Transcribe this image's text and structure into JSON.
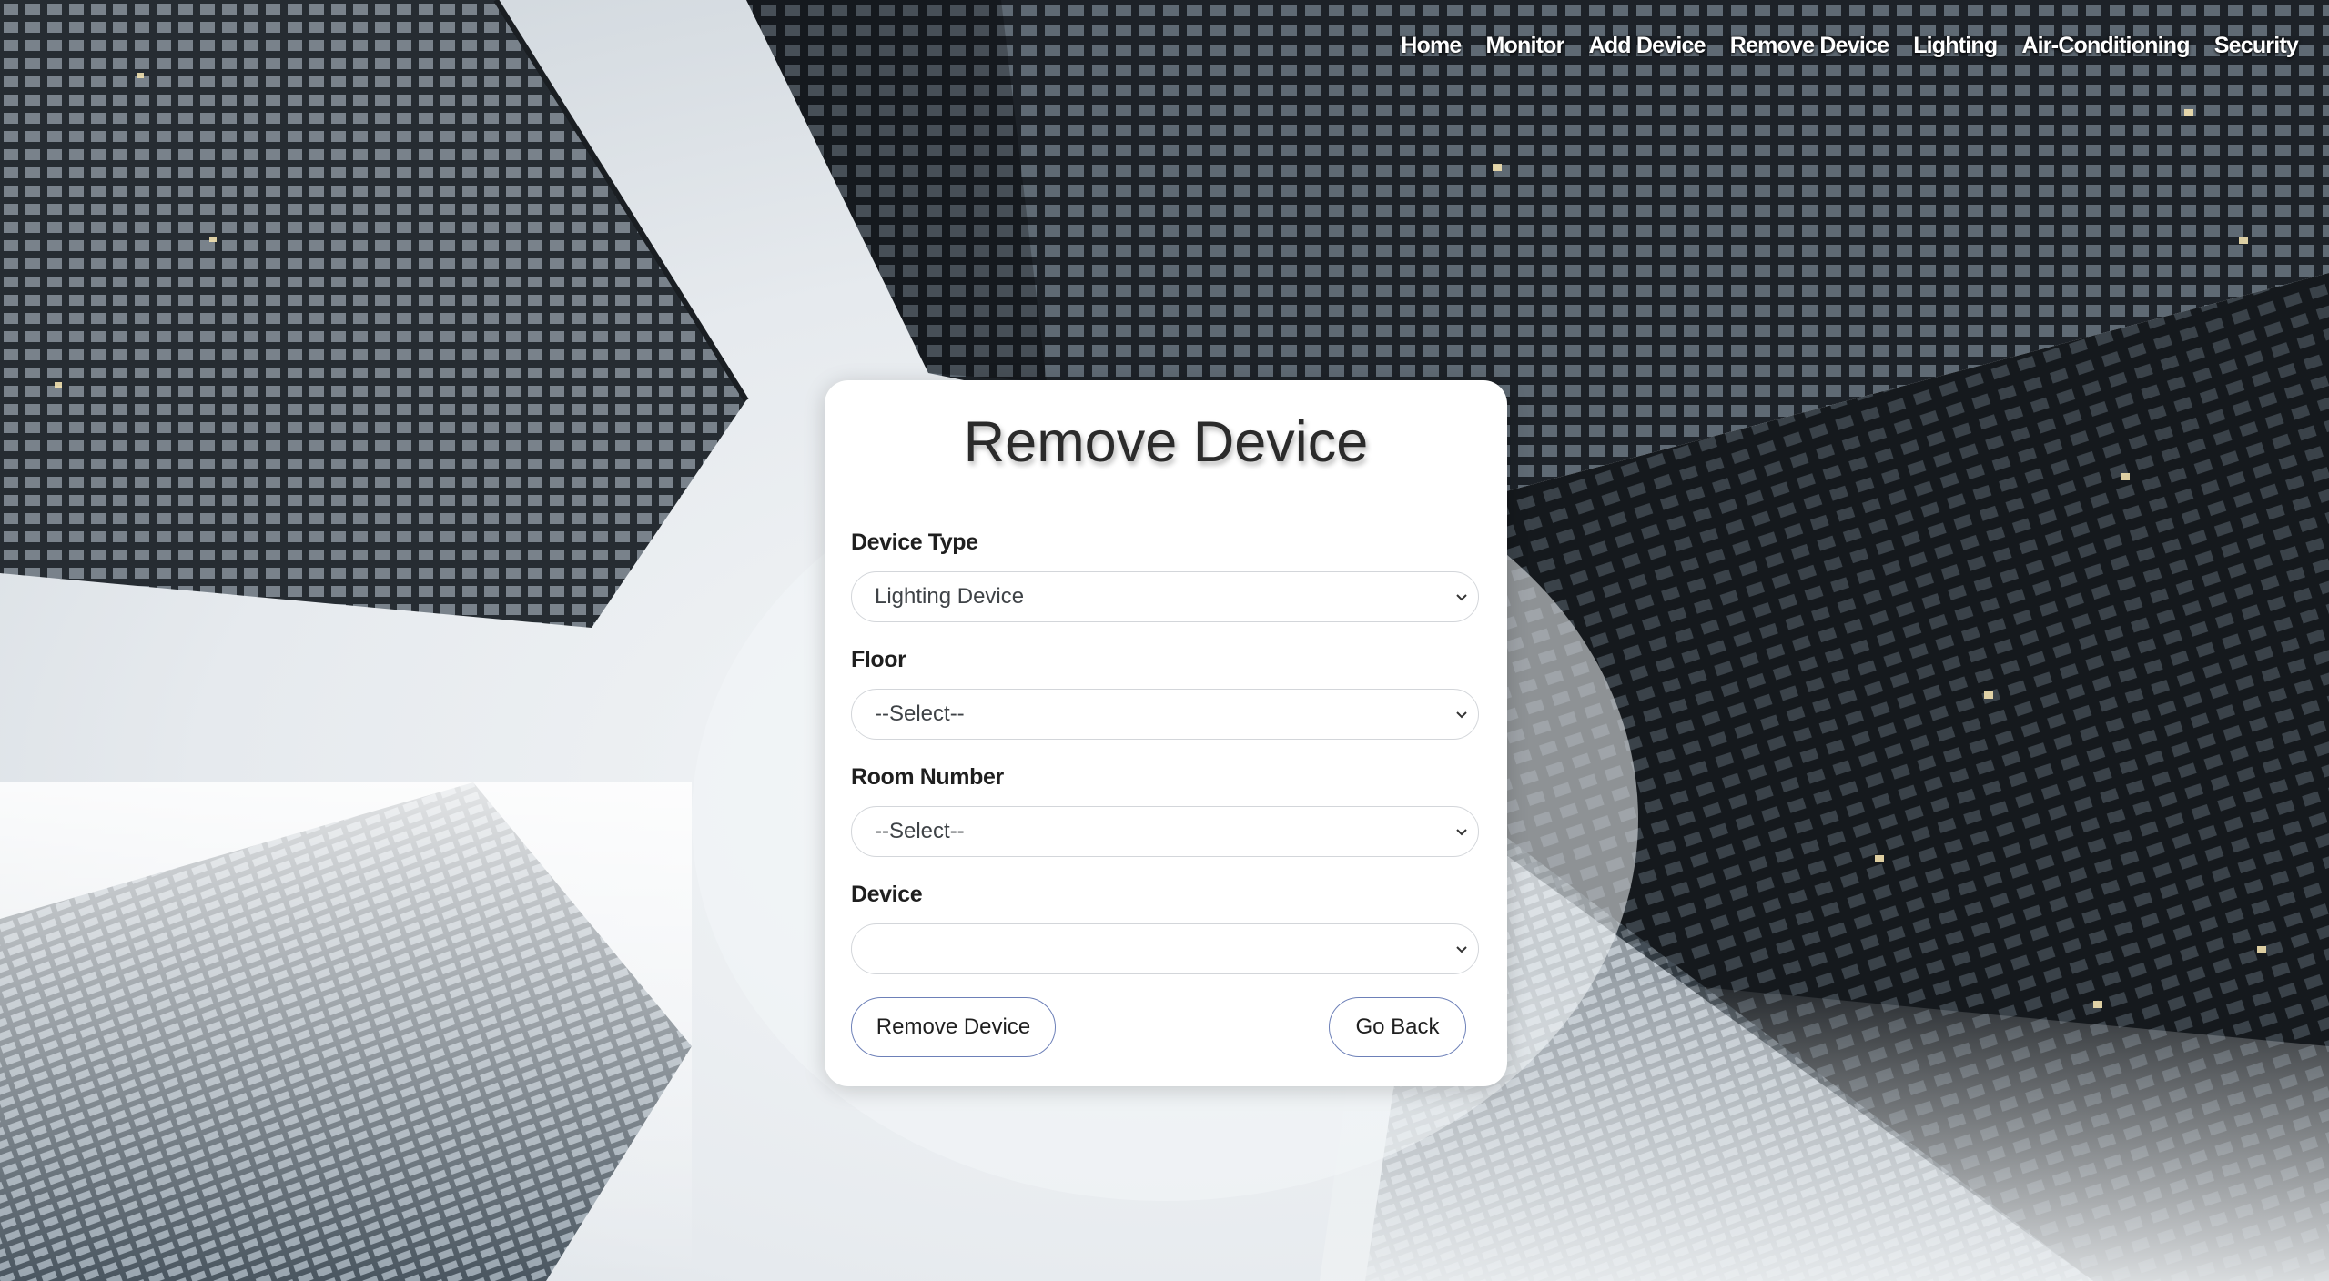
{
  "nav": {
    "items": [
      "Home",
      "Monitor",
      "Add Device",
      "Remove Device",
      "Lighting",
      "Air-Conditioning",
      "Security"
    ]
  },
  "form": {
    "title": "Remove Device",
    "fields": {
      "device_type": {
        "label": "Device Type",
        "value": "Lighting Device"
      },
      "floor": {
        "label": "Floor",
        "value": "--Select--"
      },
      "room_number": {
        "label": "Room Number",
        "value": "--Select--"
      },
      "device": {
        "label": "Device",
        "value": ""
      }
    },
    "buttons": {
      "remove": "Remove Device",
      "back": "Go Back"
    }
  },
  "icons": {
    "dropdown": "chevron-down-icon"
  },
  "colors": {
    "card_background": "#ffffff",
    "button_border": "#6d80b8",
    "nav_text": "#ffffff"
  }
}
